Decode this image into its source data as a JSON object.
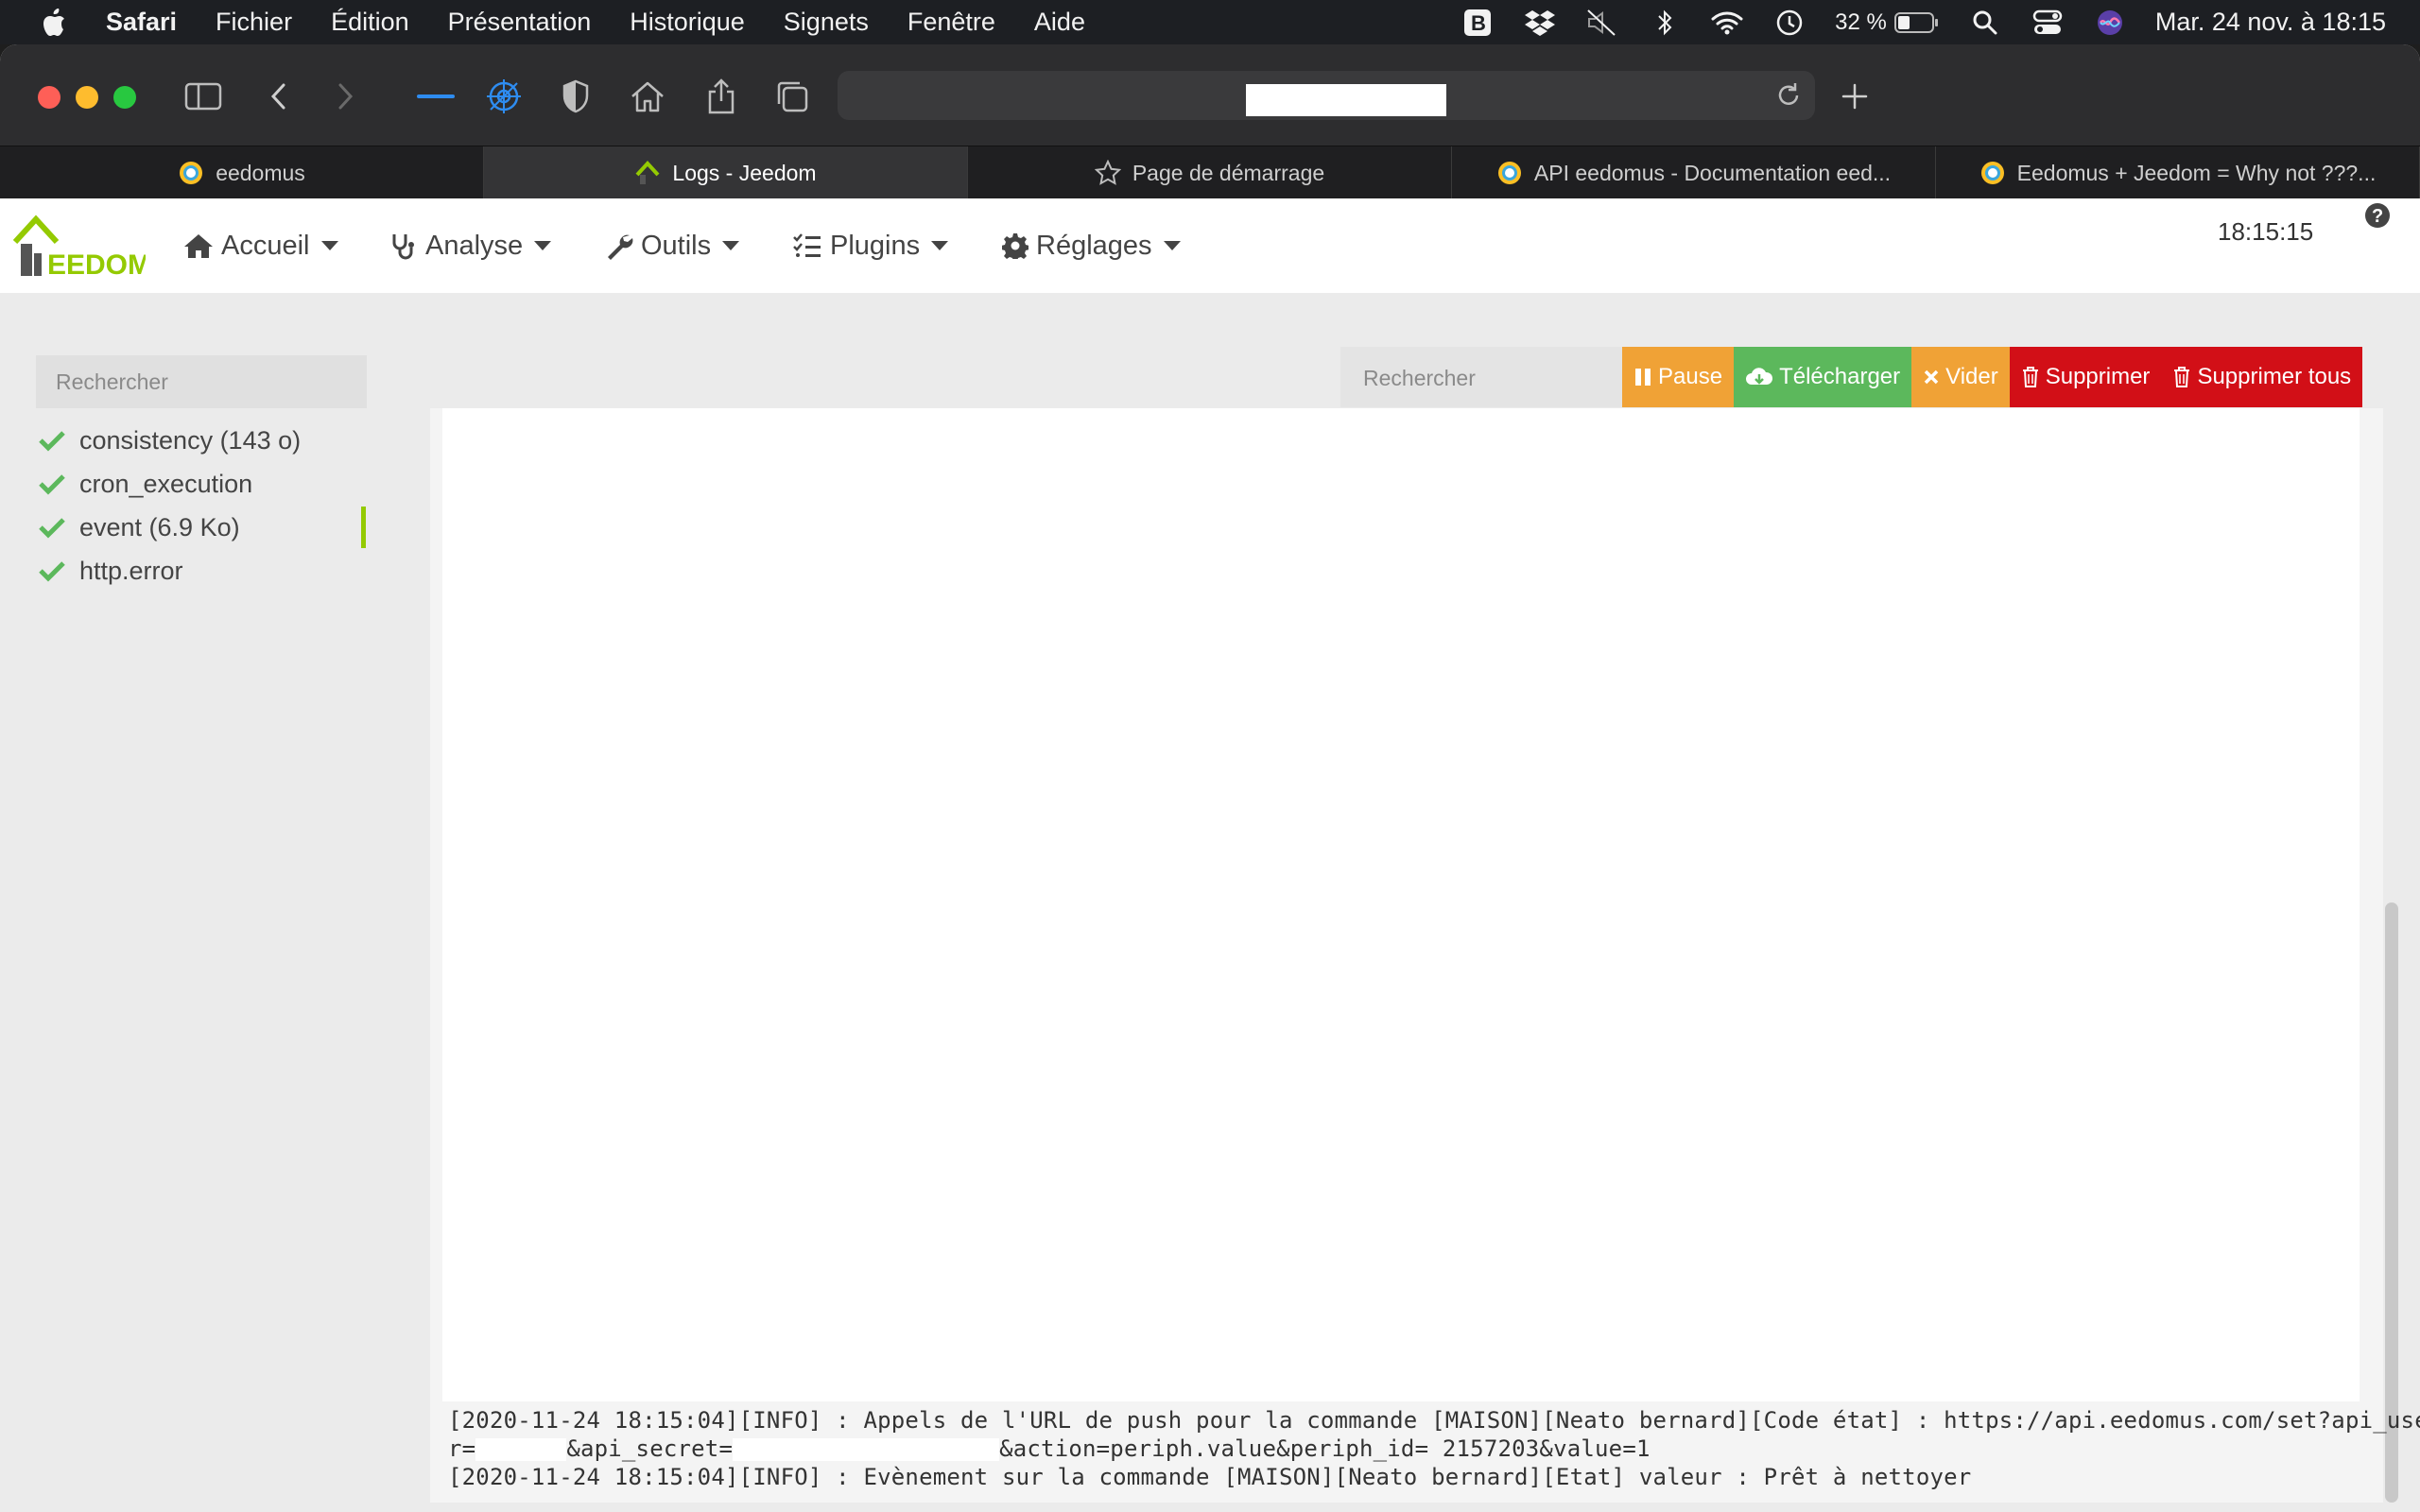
{
  "menubar": {
    "app": "Safari",
    "items": [
      "Fichier",
      "Édition",
      "Présentation",
      "Historique",
      "Signets",
      "Fenêtre",
      "Aide"
    ],
    "battery": "32 %",
    "clock": "Mar. 24 nov. à  18:15",
    "status_icons": [
      "bartender-icon",
      "dropbox-icon",
      "mute-icon",
      "bluetooth-icon",
      "wifi-icon",
      "time-machine-icon",
      "battery-icon",
      "spotlight-icon",
      "control-center-icon",
      "siri-icon"
    ]
  },
  "safari": {
    "tabs": [
      {
        "label": "eedomus",
        "icon": "eedomus-icon",
        "active": false
      },
      {
        "label": "Logs - Jeedom",
        "icon": "jeedom-icon",
        "active": true
      },
      {
        "label": "Page de démarrage",
        "icon": "star-icon",
        "active": false
      },
      {
        "label": "API eedomus - Documentation eed...",
        "icon": "eedomus-doc-icon",
        "active": false
      },
      {
        "label": "Eedomus + Jeedom = Why not ???...",
        "icon": "eedomus-forum-icon",
        "active": false
      }
    ]
  },
  "jeedom": {
    "logo_text": "EEDOM",
    "nav": [
      "Accueil",
      "Analyse",
      "Outils",
      "Plugins",
      "Réglages"
    ],
    "clock": "18:15:15",
    "sidebar_search_placeholder": "Rechercher",
    "log_files": [
      "consistency (143 o)",
      "cron_execution",
      "event (6.9 Ko)",
      "http.error"
    ],
    "log_search_placeholder": "Rechercher",
    "buttons": {
      "pause": "Pause",
      "download": "Télécharger",
      "clear": "Vider",
      "delete": "Supprimer",
      "delete_all": "Supprimer tous"
    },
    "log": {
      "line1_a": "[2020-11-24 18:15:04][INFO] : Appels de l'URL de push pour la commande [MAISON][Neato bernard][Code état] : https://api.eedomus.com/set?api_use",
      "line2_a": "r=",
      "line2_b": "&api_secret=",
      "line2_c": "&action=periph.value&periph_id= 2157203&value=1",
      "line3": "[2020-11-24 18:15:04][INFO] : Evènement sur la commande [MAISON][Neato bernard][Etat] valeur : Prêt à nettoyer"
    }
  },
  "colors": {
    "accent_green": "#94ca02",
    "btn_orange": "#f0a236",
    "btn_green": "#5cb85c",
    "btn_red": "#d20f17"
  }
}
